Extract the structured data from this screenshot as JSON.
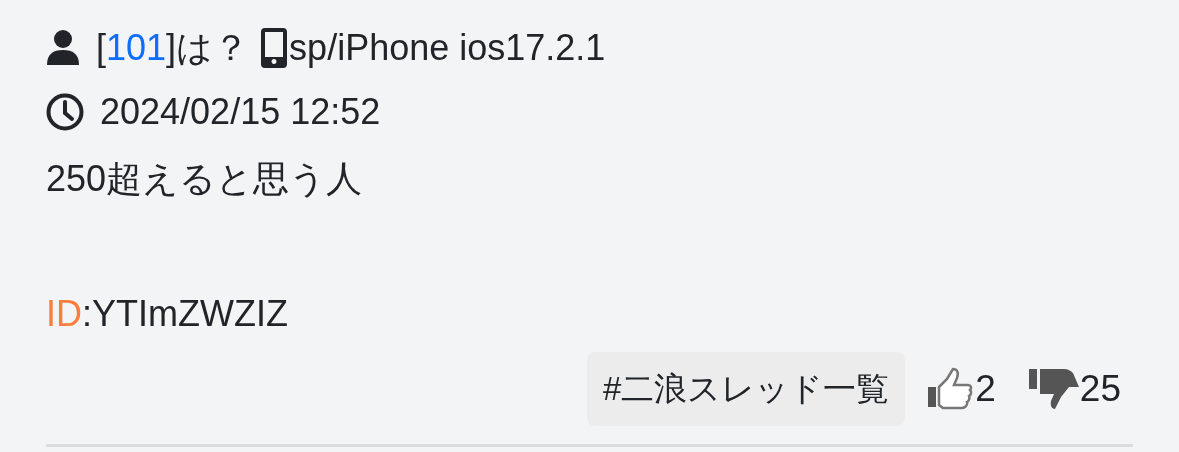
{
  "post": {
    "author": {
      "prefix": "[",
      "number": "101",
      "suffix": "]は？"
    },
    "device": "sp/iPhone ios17.2.1",
    "timestamp": "2024/02/15 12:52",
    "body": "250超えると思う人",
    "id_label": "ID",
    "id_value": ":YTImZWZIZ",
    "tag": "#二浪スレッド一覧",
    "likes": "2",
    "dislikes": "25"
  }
}
